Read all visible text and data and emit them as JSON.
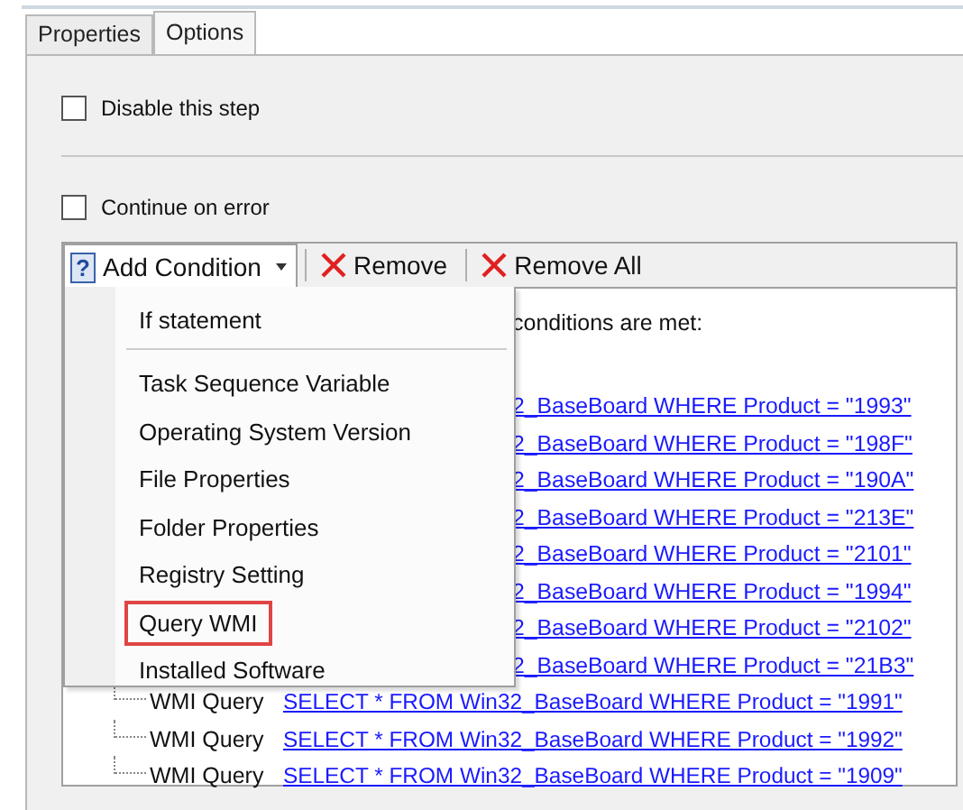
{
  "tabs": [
    {
      "label": "Properties",
      "selected": false
    },
    {
      "label": "Options",
      "selected": true
    }
  ],
  "options": [
    {
      "label": "Disable this step",
      "checked": false
    },
    {
      "label": "Continue on error",
      "checked": false
    }
  ],
  "toolbar": [
    {
      "kind": "add",
      "icon": "?",
      "label": "Add Condition",
      "pressed": true
    },
    {
      "kind": "remove",
      "label": "Remove",
      "pressed": false
    },
    {
      "kind": "remove",
      "label": "Remove All",
      "pressed": false
    }
  ],
  "conditions": {
    "header": "conditions are met:",
    "rows": [
      {
        "kind": "partial",
        "query": "2_BaseBoard WHERE Product = \"1993\""
      },
      {
        "kind": "partial",
        "query": "2_BaseBoard WHERE Product = \"198F\""
      },
      {
        "kind": "partial",
        "query": "2_BaseBoard WHERE Product = \"190A\""
      },
      {
        "kind": "partial",
        "query": "2_BaseBoard WHERE Product = \"213E\""
      },
      {
        "kind": "partial",
        "query": "2_BaseBoard WHERE Product = \"2101\""
      },
      {
        "kind": "partial",
        "query": "2_BaseBoard WHERE Product = \"1994\""
      },
      {
        "kind": "partial",
        "query": "2_BaseBoard WHERE Product = \"2102\""
      },
      {
        "kind": "partial",
        "query": "2_BaseBoard WHERE Product = \"21B3\""
      },
      {
        "kind": "full",
        "label": "WMI Query",
        "query": "SELECT * FROM Win32_BaseBoard WHERE Product = \"1991\""
      },
      {
        "kind": "full",
        "label": "WMI Query",
        "query": "SELECT * FROM Win32_BaseBoard WHERE Product = \"1992\""
      },
      {
        "kind": "full",
        "label": "WMI Query",
        "query": "SELECT * FROM Win32_BaseBoard WHERE Product = \"1909\""
      }
    ]
  },
  "menu": {
    "groups": [
      [
        {
          "label": "If statement",
          "marked": false
        }
      ],
      [
        {
          "label": "Task Sequence Variable",
          "marked": false
        },
        {
          "label": "Operating System Version",
          "marked": false
        },
        {
          "label": "File Properties",
          "marked": false
        },
        {
          "label": "Folder Properties",
          "marked": false
        },
        {
          "label": "Registry Setting",
          "marked": false
        },
        {
          "label": "Query WMI",
          "marked": true
        },
        {
          "label": "Installed Software",
          "marked": false
        }
      ]
    ]
  }
}
